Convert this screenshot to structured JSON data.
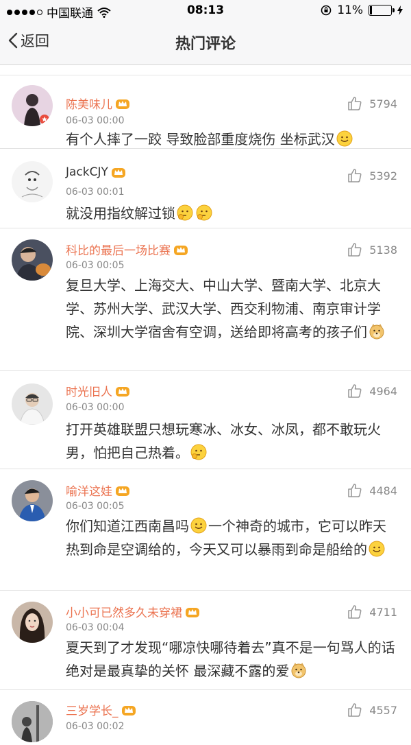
{
  "status_bar": {
    "carrier": "中国联通",
    "time": "08:13",
    "battery": "11%",
    "battery_level": 0.11
  },
  "nav": {
    "back_label": "返回",
    "title": "热门评论"
  },
  "comments": [
    {
      "name": "陈美味儿",
      "time": "06-03 00:00",
      "likes": "5794",
      "text": "有个人摔了一跤 导致脸部重度烧伤 坐标武汉"
    },
    {
      "name": "JackCJY",
      "time": "06-03 00:01",
      "likes": "5392",
      "text": "就没用指纹解过锁"
    },
    {
      "name": "科比的最后一场比赛",
      "time": "06-03 00:05",
      "likes": "5138",
      "text": "复旦大学、上海交大、中山大学、暨南大学、北京大学、苏州大学、武汉大学、西交利物浦、南京审计学院、深圳大学宿舍有空调，送给即将高考的孩子们"
    },
    {
      "name": "时光旧人",
      "time": "06-03 00:00",
      "likes": "4964",
      "text": "打开英雄联盟只想玩寒冰、冰女、冰凤，都不敢玩火男，怕把自己热着。"
    },
    {
      "name": "喻洋这娃",
      "time": "06-03 00:05",
      "likes": "4484",
      "text_a": "你们知道江西南昌吗",
      "text_b": "一个神奇的城市，它可以昨天热到命是空调给的，今天又可以暴雨到命是船给的"
    },
    {
      "name": "小小可已然多久未穿裙",
      "time": "06-03 00:04",
      "likes": "4711",
      "text": "夏天到了才发现“哪凉快哪待着去”真不是一句骂人的话 绝对是最真挚的关怀 最深藏不露的爱"
    },
    {
      "name": "三岁学长_",
      "time": "06-03 00:02",
      "likes": "4557"
    }
  ]
}
